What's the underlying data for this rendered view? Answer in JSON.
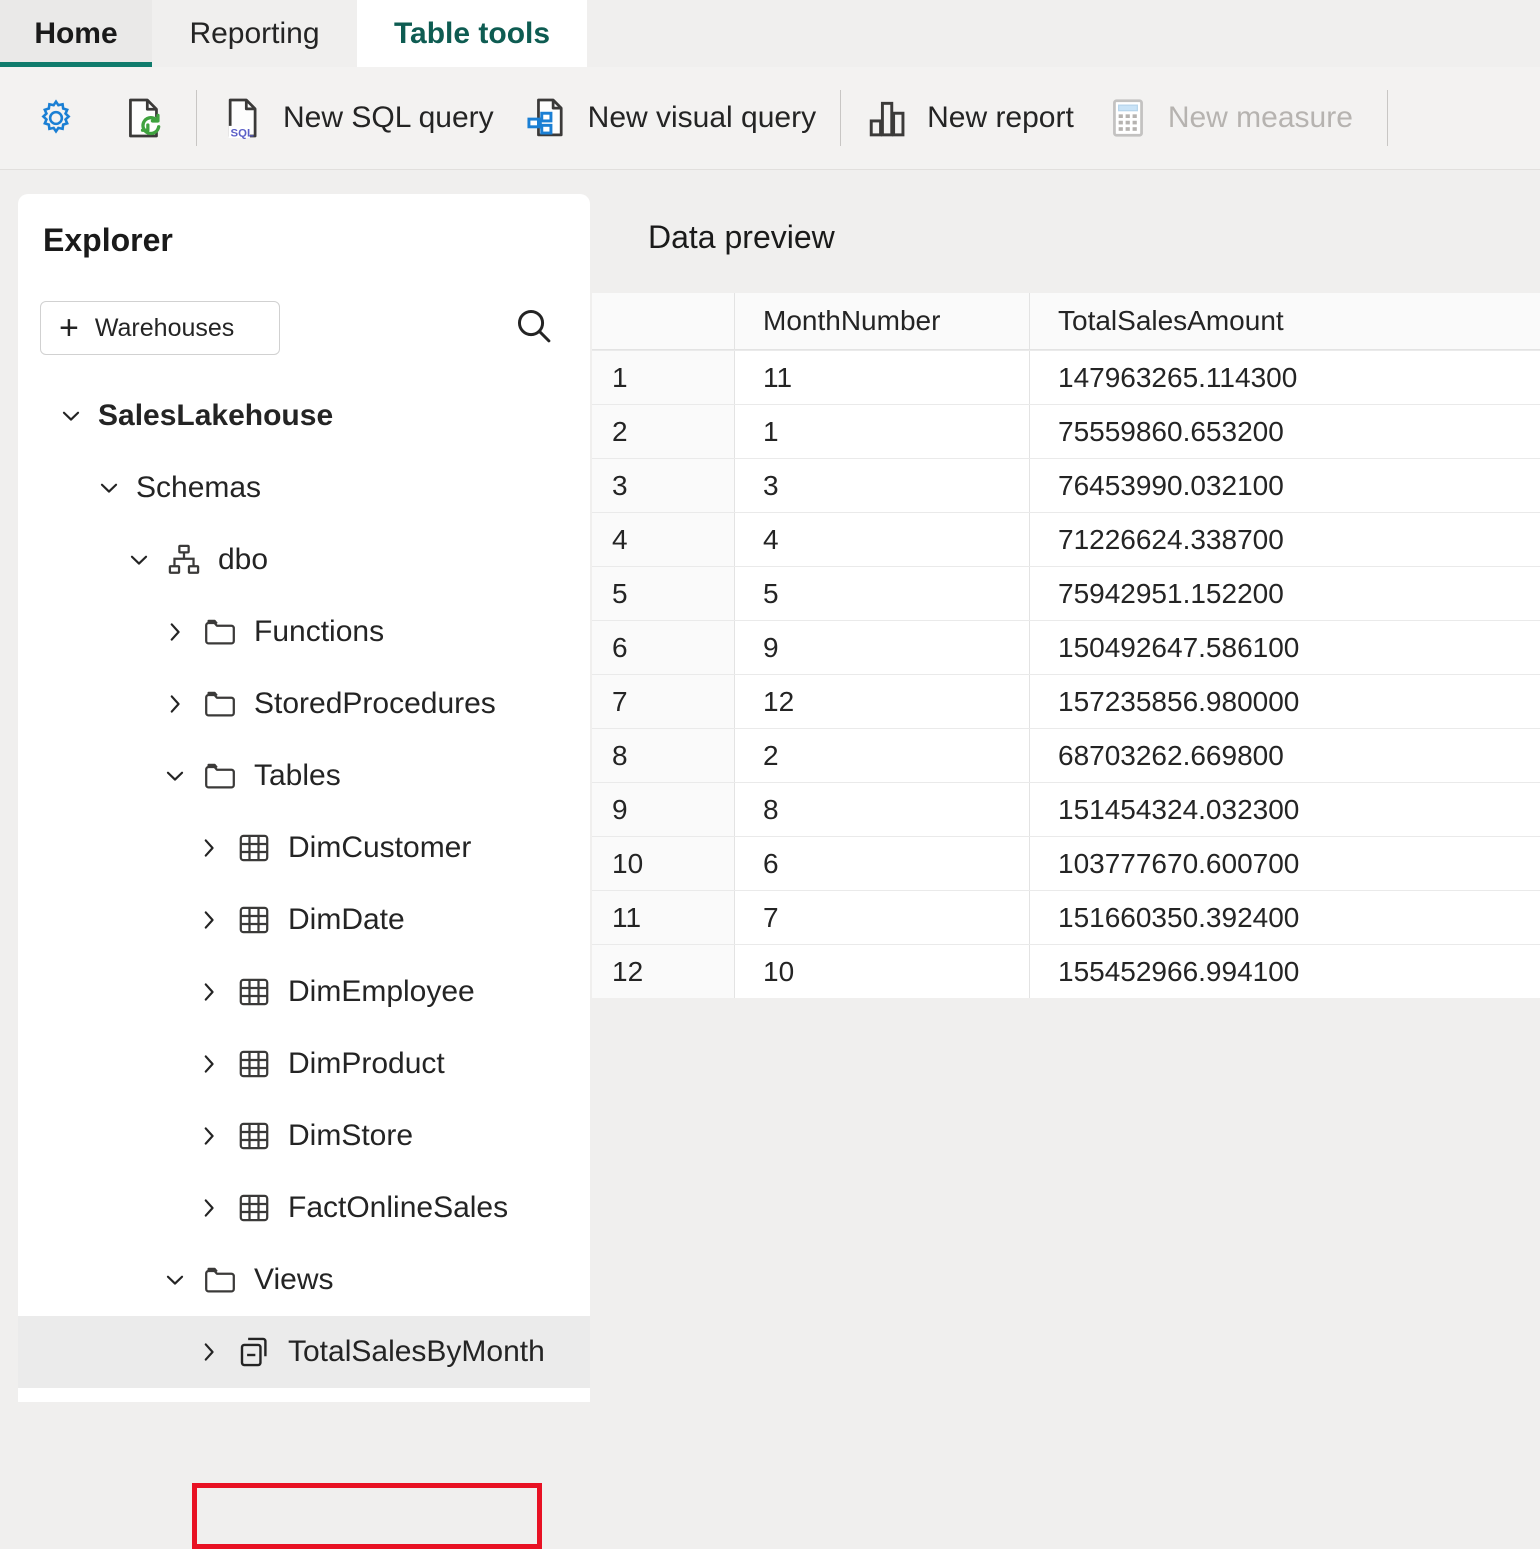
{
  "ribbon": {
    "tabs": [
      {
        "label": "Home",
        "state": "underlined"
      },
      {
        "label": "Reporting",
        "state": "inactive"
      },
      {
        "label": "Table tools",
        "state": "active"
      }
    ]
  },
  "command_bar": {
    "buttons": [
      {
        "label": "",
        "icon": "settings-gear-icon",
        "disabled": false
      },
      {
        "label": "",
        "icon": "refresh-file-icon",
        "disabled": false
      },
      {
        "label": "New SQL query",
        "icon": "sql-file-icon",
        "disabled": false
      },
      {
        "label": "New visual query",
        "icon": "visual-query-icon",
        "disabled": false
      },
      {
        "label": "New report",
        "icon": "bar-chart-icon",
        "disabled": false
      },
      {
        "label": "New measure",
        "icon": "calculator-icon",
        "disabled": true
      }
    ]
  },
  "explorer": {
    "title": "Explorer",
    "warehouses_button": "Warehouses",
    "search_icon": "search-icon",
    "tree": [
      {
        "label": "SalesLakehouse",
        "level": 0,
        "chevron": "down",
        "icon": "none",
        "bold": true,
        "selected": false
      },
      {
        "label": "Schemas",
        "level": 1,
        "chevron": "down",
        "icon": "none",
        "bold": false,
        "selected": false
      },
      {
        "label": "dbo",
        "level": 2,
        "chevron": "down",
        "icon": "schema-icon",
        "bold": false,
        "selected": false
      },
      {
        "label": "Functions",
        "level": 3,
        "chevron": "right",
        "icon": "folder-icon",
        "bold": false,
        "selected": false
      },
      {
        "label": "StoredProcedures",
        "level": 3,
        "chevron": "right",
        "icon": "folder-icon",
        "bold": false,
        "selected": false
      },
      {
        "label": "Tables",
        "level": 3,
        "chevron": "down",
        "icon": "folder-icon",
        "bold": false,
        "selected": false
      },
      {
        "label": "DimCustomer",
        "level": 4,
        "chevron": "right",
        "icon": "table-icon",
        "bold": false,
        "selected": false
      },
      {
        "label": "DimDate",
        "level": 4,
        "chevron": "right",
        "icon": "table-icon",
        "bold": false,
        "selected": false
      },
      {
        "label": "DimEmployee",
        "level": 4,
        "chevron": "right",
        "icon": "table-icon",
        "bold": false,
        "selected": false
      },
      {
        "label": "DimProduct",
        "level": 4,
        "chevron": "right",
        "icon": "table-icon",
        "bold": false,
        "selected": false
      },
      {
        "label": "DimStore",
        "level": 4,
        "chevron": "right",
        "icon": "table-icon",
        "bold": false,
        "selected": false
      },
      {
        "label": "FactOnlineSales",
        "level": 4,
        "chevron": "right",
        "icon": "table-icon",
        "bold": false,
        "selected": false
      },
      {
        "label": "Views",
        "level": 3,
        "chevron": "down",
        "icon": "folder-icon",
        "bold": false,
        "selected": false
      },
      {
        "label": "TotalSalesByMonth",
        "level": 4,
        "chevron": "right",
        "icon": "view-icon",
        "bold": false,
        "selected": true
      }
    ]
  },
  "data_preview": {
    "title": "Data preview",
    "columns": [
      "",
      "MonthNumber",
      "TotalSalesAmount"
    ],
    "rows": [
      {
        "index": "1",
        "MonthNumber": "11",
        "TotalSalesAmount": "147963265.114300"
      },
      {
        "index": "2",
        "MonthNumber": "1",
        "TotalSalesAmount": "75559860.653200"
      },
      {
        "index": "3",
        "MonthNumber": "3",
        "TotalSalesAmount": "76453990.032100"
      },
      {
        "index": "4",
        "MonthNumber": "4",
        "TotalSalesAmount": "71226624.338700"
      },
      {
        "index": "5",
        "MonthNumber": "5",
        "TotalSalesAmount": "75942951.152200"
      },
      {
        "index": "6",
        "MonthNumber": "9",
        "TotalSalesAmount": "150492647.586100"
      },
      {
        "index": "7",
        "MonthNumber": "12",
        "TotalSalesAmount": "157235856.980000"
      },
      {
        "index": "8",
        "MonthNumber": "2",
        "TotalSalesAmount": "68703262.669800"
      },
      {
        "index": "9",
        "MonthNumber": "8",
        "TotalSalesAmount": "151454324.032300"
      },
      {
        "index": "10",
        "MonthNumber": "6",
        "TotalSalesAmount": "103777670.600700"
      },
      {
        "index": "11",
        "MonthNumber": "7",
        "TotalSalesAmount": "151660350.392400"
      },
      {
        "index": "12",
        "MonthNumber": "10",
        "TotalSalesAmount": "155452966.994100"
      }
    ]
  },
  "colors": {
    "accent_teal": "#0f7b6c",
    "active_tab_text": "#0e5c52",
    "highlight_red": "#e81123",
    "icon_blue": "#0f6cbd",
    "icon_green": "#3fa23f",
    "page_bg": "#f0efee"
  }
}
